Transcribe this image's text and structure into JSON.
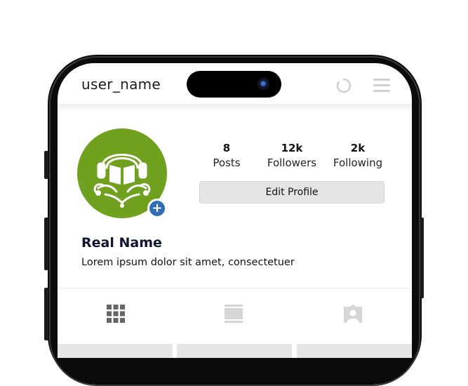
{
  "header": {
    "username": "user_name",
    "icons": [
      "refresh-icon",
      "menu-icon"
    ]
  },
  "profile": {
    "avatar_icon": "book-emblem-icon",
    "avatar_color": "#6fa11f",
    "add_badge_icon": "plus-icon",
    "add_badge_color": "#2f6db5",
    "add_badge_label": "+",
    "stats": [
      {
        "value": "8",
        "label": "Posts"
      },
      {
        "value": "12k",
        "label": "Followers"
      },
      {
        "value": "2k",
        "label": "Following"
      }
    ],
    "edit_button_label": "Edit Profile",
    "real_name": "Real Name",
    "bio": "Lorem ipsum dolor sit amet, consectetuer"
  },
  "tabs": [
    {
      "icon": "grid-icon",
      "active": true
    },
    {
      "icon": "reels-icon",
      "active": false
    },
    {
      "icon": "tagged-icon",
      "active": false
    }
  ]
}
